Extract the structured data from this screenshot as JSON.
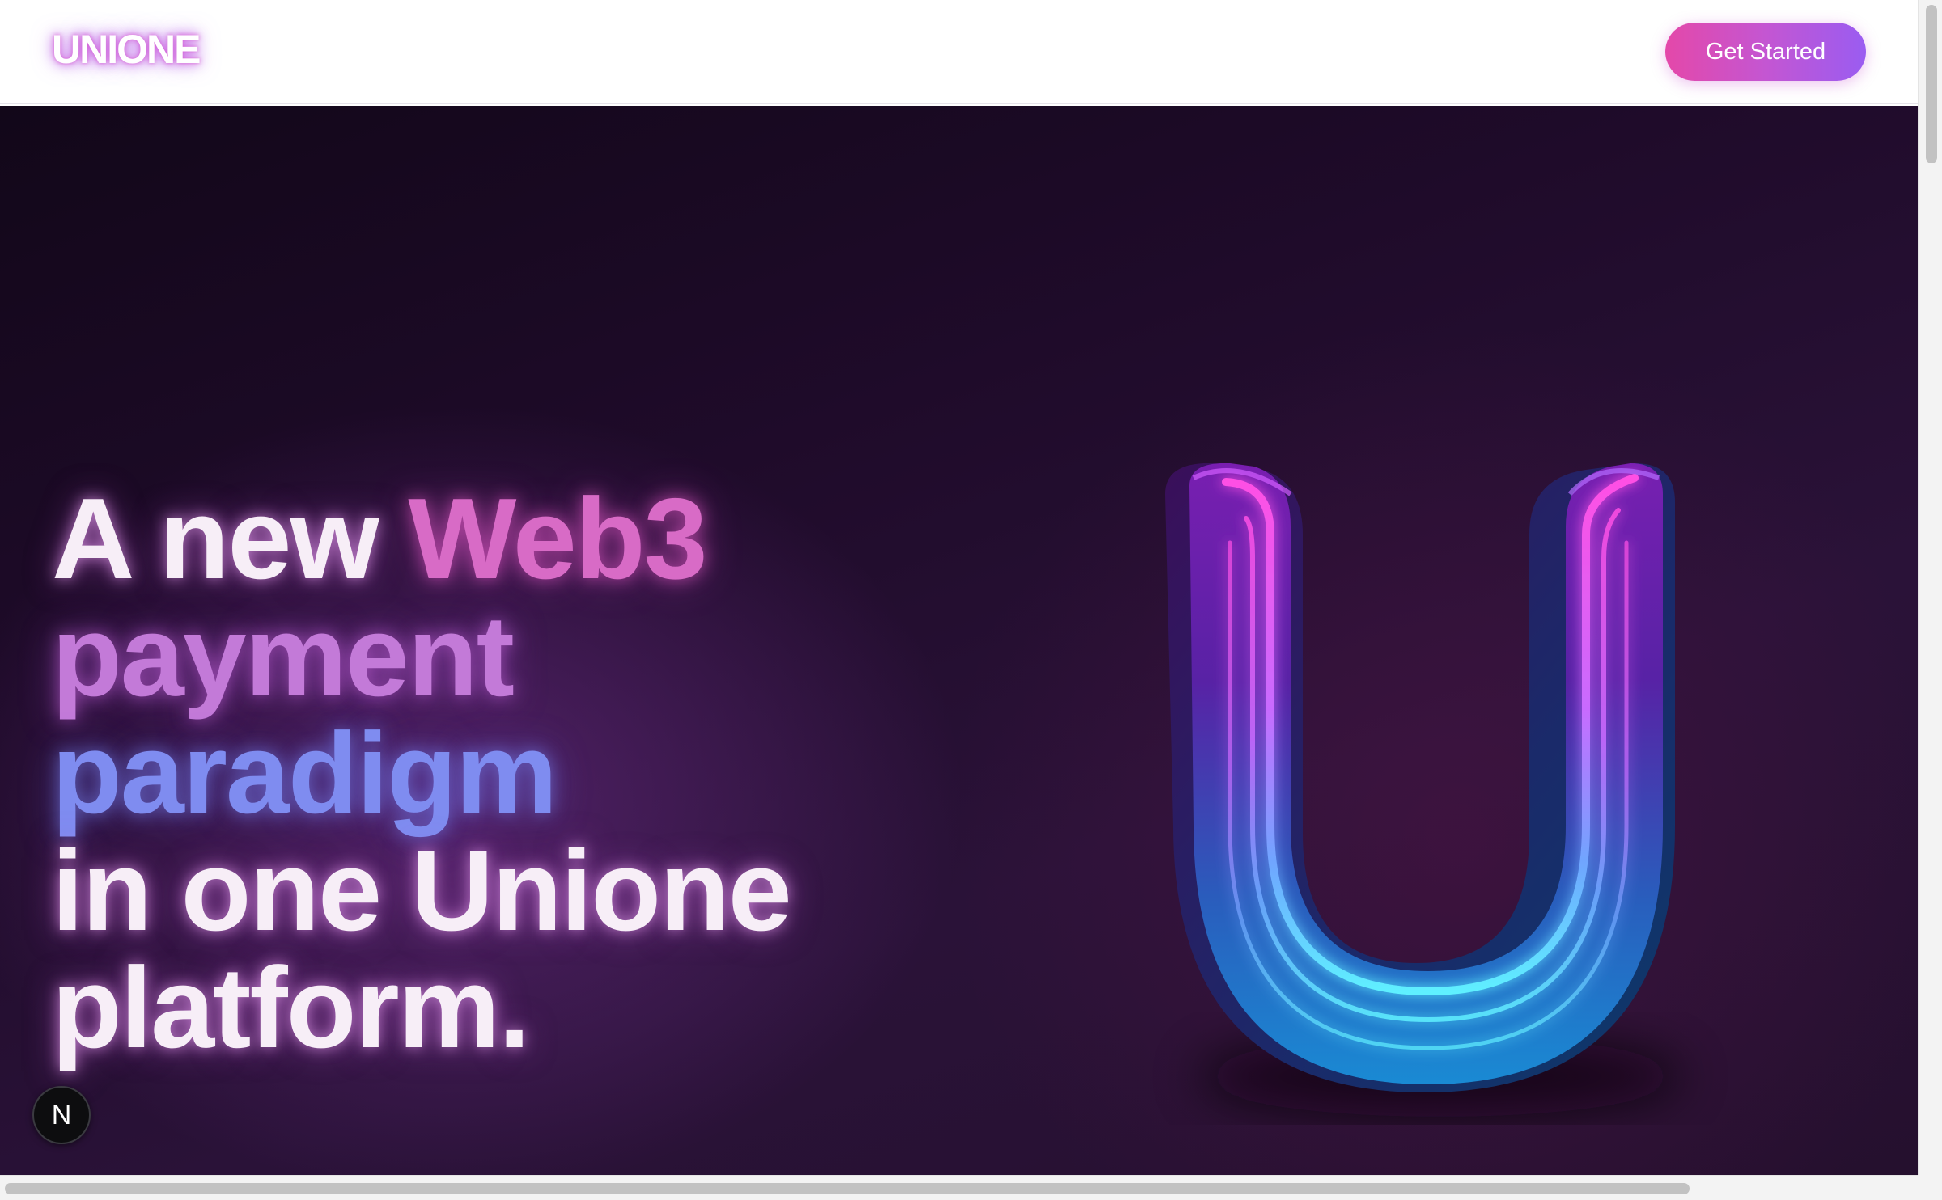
{
  "header": {
    "logo_text": "UNIONE",
    "cta_label": "Get Started"
  },
  "hero": {
    "headline": {
      "word_a": "A new",
      "word_web3": "Web3",
      "word_payment": "payment",
      "word_paradigm": "paradigm",
      "line4": "in one Unione",
      "line5": "platform."
    },
    "hero_image": "neon-u-logo-3d"
  },
  "badge": {
    "label": "N",
    "icon": "nextjs-icon"
  },
  "colors": {
    "cta_gradient_start": "#e448a9",
    "cta_gradient_end": "#9a5cf1",
    "hero_background": "#1f0b2a",
    "web3_accent": "#d86bc6",
    "payment_accent": "#c37ad8",
    "paradigm_accent": "#7f8cf0"
  }
}
